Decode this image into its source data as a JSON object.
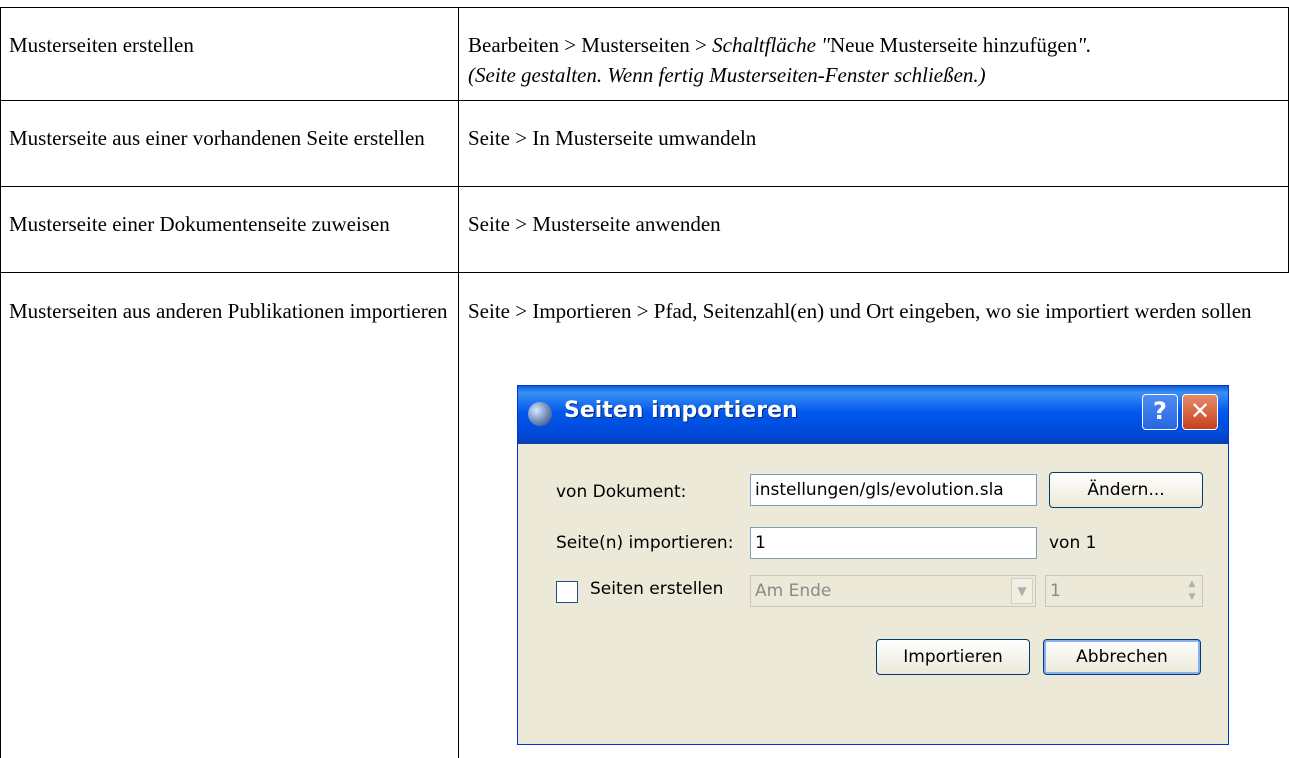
{
  "rows": [
    {
      "left": "Musterseiten erstellen",
      "right_normal_1": "Bearbeiten > Musterseiten > ",
      "right_italic_1": "Schaltfläche \"",
      "right_normal_2": "Neue Musterseite hinzufügen",
      "right_italic_2": "\".",
      "right_italic_line2": "(Seite gestalten. Wenn fertig Musterseiten-Fenster schließen.)"
    },
    {
      "left": "Musterseite aus einer vorhandenen Seite erstellen",
      "right": "Seite > In Musterseite umwandeln"
    },
    {
      "left": "Musterseite einer Dokumentenseite zuweisen",
      "right": "Seite > Musterseite anwenden"
    },
    {
      "left": "Musterseiten aus anderen Publikationen importieren",
      "right": "Seite > Importieren > Pfad, Seitenzahl(en) und Ort eingeben, wo sie im­portiert werden sollen"
    }
  ],
  "dialog": {
    "title": "Seiten importieren",
    "help": "?",
    "close": "✕",
    "doc_label": "von Dokument:",
    "doc_value": "instellungen/gls/evolution.sla",
    "change_button": "Ändern...",
    "pages_label": "Seite(n) importieren:",
    "pages_value": "1",
    "of_label": "von 1",
    "create_label": "Seiten erstellen",
    "position_value": "Am Ende",
    "count_value": "1",
    "import_button": "Importieren",
    "cancel_button": "Abbrechen"
  }
}
